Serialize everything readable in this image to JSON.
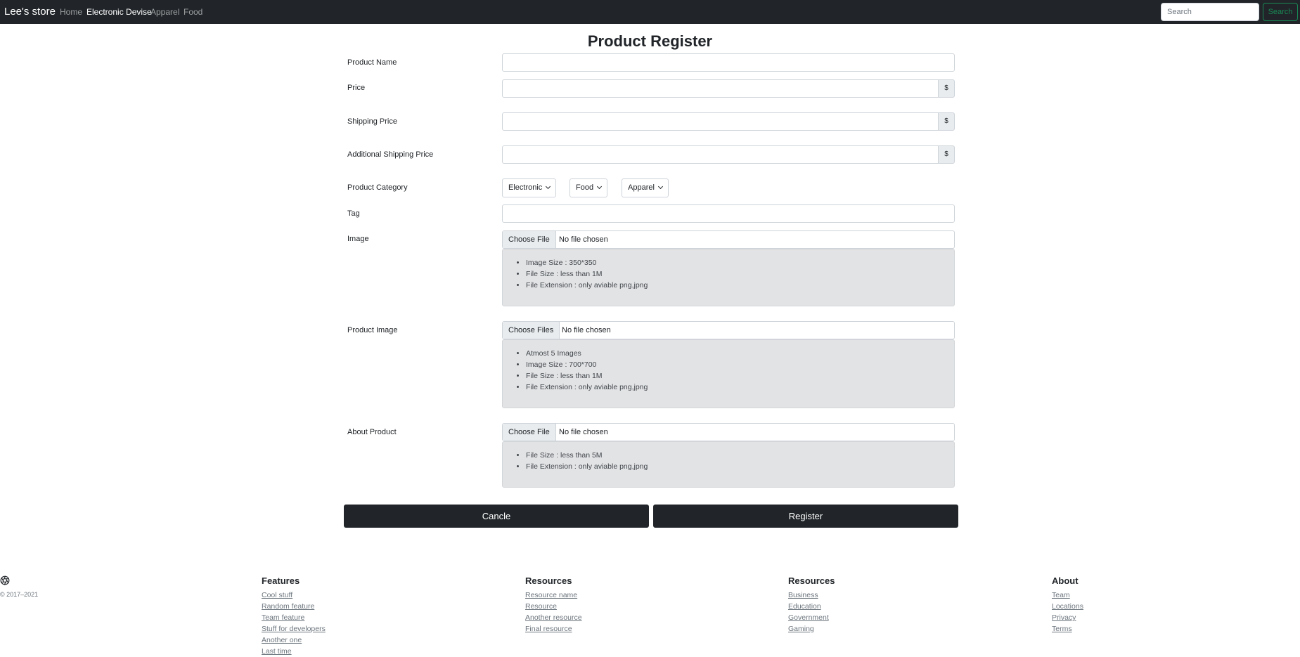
{
  "navbar": {
    "brand": "Lee's store",
    "links": [
      "Home",
      "Electronic Devise",
      "Apparel",
      "Food"
    ],
    "active_link": "Electronic Devise",
    "search_placeholder": "Search",
    "search_button": "Search"
  },
  "form": {
    "title": "Product Register",
    "product_name_label": "Product Name",
    "price_label": "Price",
    "shipping_price_label": "Shipping Price",
    "additional_shipping_label": "Additional Shipping Price",
    "currency_symbol": "$",
    "category_label": "Product Category",
    "categories": [
      "Electronic",
      "Food",
      "Apparel"
    ],
    "tag_label": "Tag",
    "image_label": "Image",
    "image_choose": "Choose File",
    "image_status": "No file chosen",
    "image_rules": [
      "Image Size : 350*350",
      "File Size : less than 1M",
      "File Extension : only aviable png,jpng"
    ],
    "product_image_label": "Product Image",
    "product_image_choose": "Choose Files",
    "product_image_status": "No file chosen",
    "product_image_rules": [
      "Atmost 5 Images",
      "Image Size : 700*700",
      "File Size : less than 1M",
      "File Extension : only aviable png,jpng"
    ],
    "about_label": "About Product",
    "about_choose": "Choose File",
    "about_status": "No file chosen",
    "about_rules": [
      "File Size : less than 5M",
      "File Extension : only aviable png,jpng"
    ],
    "cancel_button": "Cancle",
    "register_button": "Register"
  },
  "footer": {
    "logo_icon": "aperture-icon",
    "copyright": "© 2017–2021",
    "columns": [
      {
        "title": "Features",
        "links": [
          "Cool stuff",
          "Random feature",
          "Team feature",
          "Stuff for developers",
          "Another one",
          "Last time"
        ]
      },
      {
        "title": "Resources",
        "links": [
          "Resource name",
          "Resource",
          "Another resource",
          "Final resource"
        ]
      },
      {
        "title": "Resources",
        "links": [
          "Business",
          "Education",
          "Government",
          "Gaming"
        ]
      },
      {
        "title": "About",
        "links": [
          "Team",
          "Locations",
          "Privacy",
          "Terms"
        ]
      }
    ]
  }
}
